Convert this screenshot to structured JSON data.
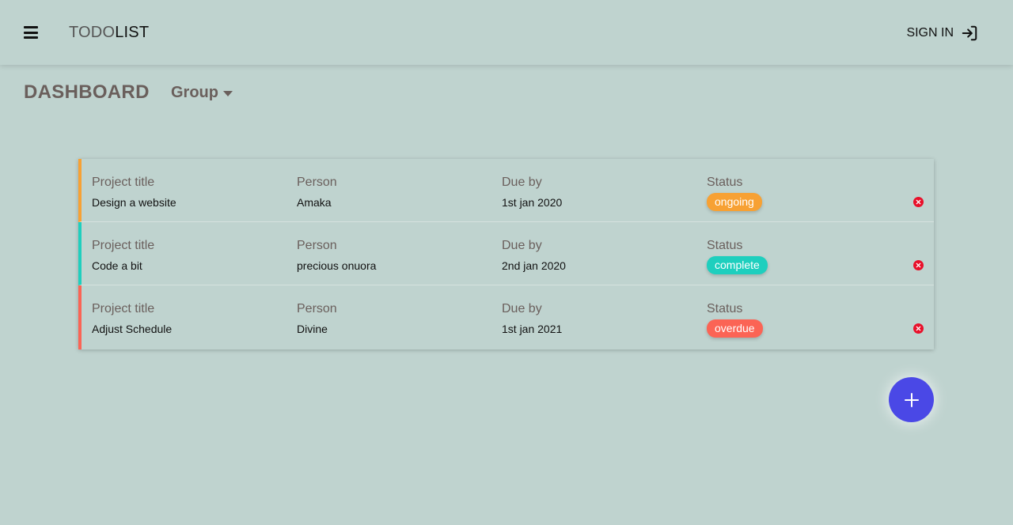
{
  "header": {
    "brand_part1": "TODO",
    "brand_part2": "LIST",
    "signin_label": "SIGN IN"
  },
  "page": {
    "title": "DASHBOARD",
    "group_label": "Group"
  },
  "columns": {
    "project": "Project title",
    "person": "Person",
    "due": "Due by",
    "status": "Status"
  },
  "rows": [
    {
      "project": "Design a website",
      "person": "Amaka",
      "due": "1st jan 2020",
      "status": "ongoing",
      "color": "#f7a134"
    },
    {
      "project": "Code a bit",
      "person": "precious onuora",
      "due": "2nd jan 2020",
      "status": "complete",
      "color": "#1ecfbe"
    },
    {
      "project": "Adjust Schedule",
      "person": "Divine",
      "due": "1st jan 2021",
      "status": "overdue",
      "color": "#fb6455"
    }
  ],
  "icons": {
    "menu": "hamburger-menu-icon",
    "signin": "sign-in-icon",
    "group_caret": "caret-down-icon",
    "delete": "delete-icon",
    "add": "plus-icon"
  },
  "colors": {
    "background": "#bfd3cf",
    "text_muted": "#6a5f5c",
    "delete": "#e8102a",
    "fab": "#4a48e6"
  }
}
